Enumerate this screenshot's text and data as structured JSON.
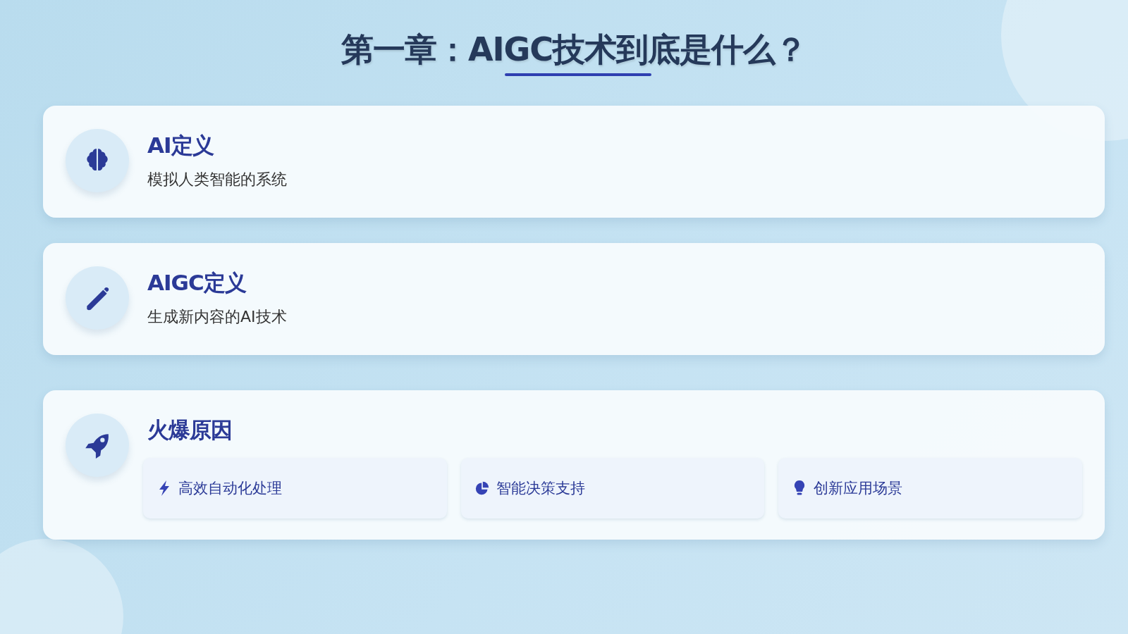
{
  "title": "第一章：AIGC技术到底是什么？",
  "cards": [
    {
      "title": "AI定义",
      "text": "模拟人类智能的系统"
    },
    {
      "title": "AIGC定义",
      "text": "生成新内容的AI技术"
    },
    {
      "title": "火爆原因",
      "items": [
        {
          "label": "高效自动化处理"
        },
        {
          "label": "智能决策支持"
        },
        {
          "label": "创新应用场景"
        }
      ]
    }
  ]
}
